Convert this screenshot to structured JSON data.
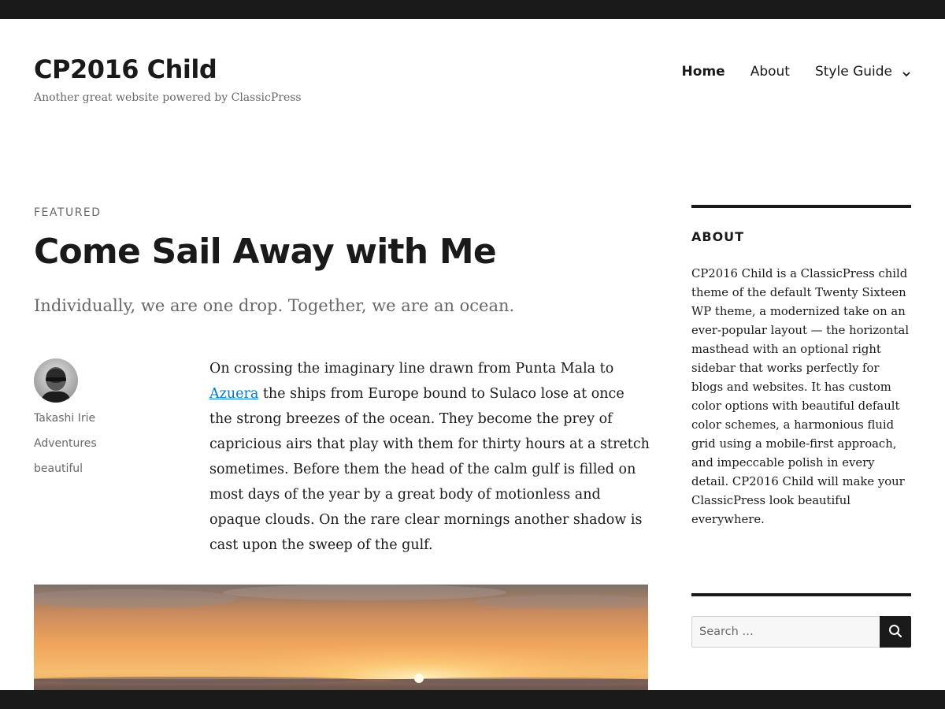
{
  "site": {
    "title": "CP2016 Child",
    "description": "Another great website powered by ClassicPress"
  },
  "nav": {
    "items": [
      {
        "label": "Home"
      },
      {
        "label": "About"
      },
      {
        "label": "Style Guide"
      }
    ]
  },
  "post": {
    "sticky_label": "FEATURED",
    "title": "Come Sail Away with Me",
    "excerpt": "Individually, we are one drop. Together, we are an ocean.",
    "author": "Takashi Irie",
    "category": "Adventures",
    "tag": "beautiful",
    "content_before_link": "On crossing the imaginary line drawn from Punta Mala to ",
    "content_link": "Azuera",
    "content_after_link": " the ships from Europe bound to Sulaco lose at once the strong breezes of the ocean. They become the prey of capricious airs that play with them for thirty hours at a stretch sometimes. Before them the head of the calm gulf is filled on most days of the year by a great body of motionless and opaque clouds. On the rare clear mornings another shadow is cast upon the sweep of the gulf."
  },
  "sidebar": {
    "about_title": "ABOUT",
    "about_text": "CP2016 Child is a ClassicPress child theme of the default Twenty Sixteen WP theme, a modernized take on an ever-popular layout — the horizontal masthead with an optional right sidebar that works perfectly for blogs and websites. It has custom color options with beautiful default color schemes, a harmonious fluid grid using a mobile-first approach, and impeccable polish in every detail. CP2016 Child will make your ClassicPress look beautiful everywhere.",
    "search_placeholder": "Search …"
  },
  "icons": {
    "submenu": "chevron-down-icon",
    "search": "search-icon"
  },
  "colors": {
    "text": "#1a1a1a",
    "secondary_text": "#686868",
    "link": "#007acc",
    "frame": "#1a1a1a"
  }
}
